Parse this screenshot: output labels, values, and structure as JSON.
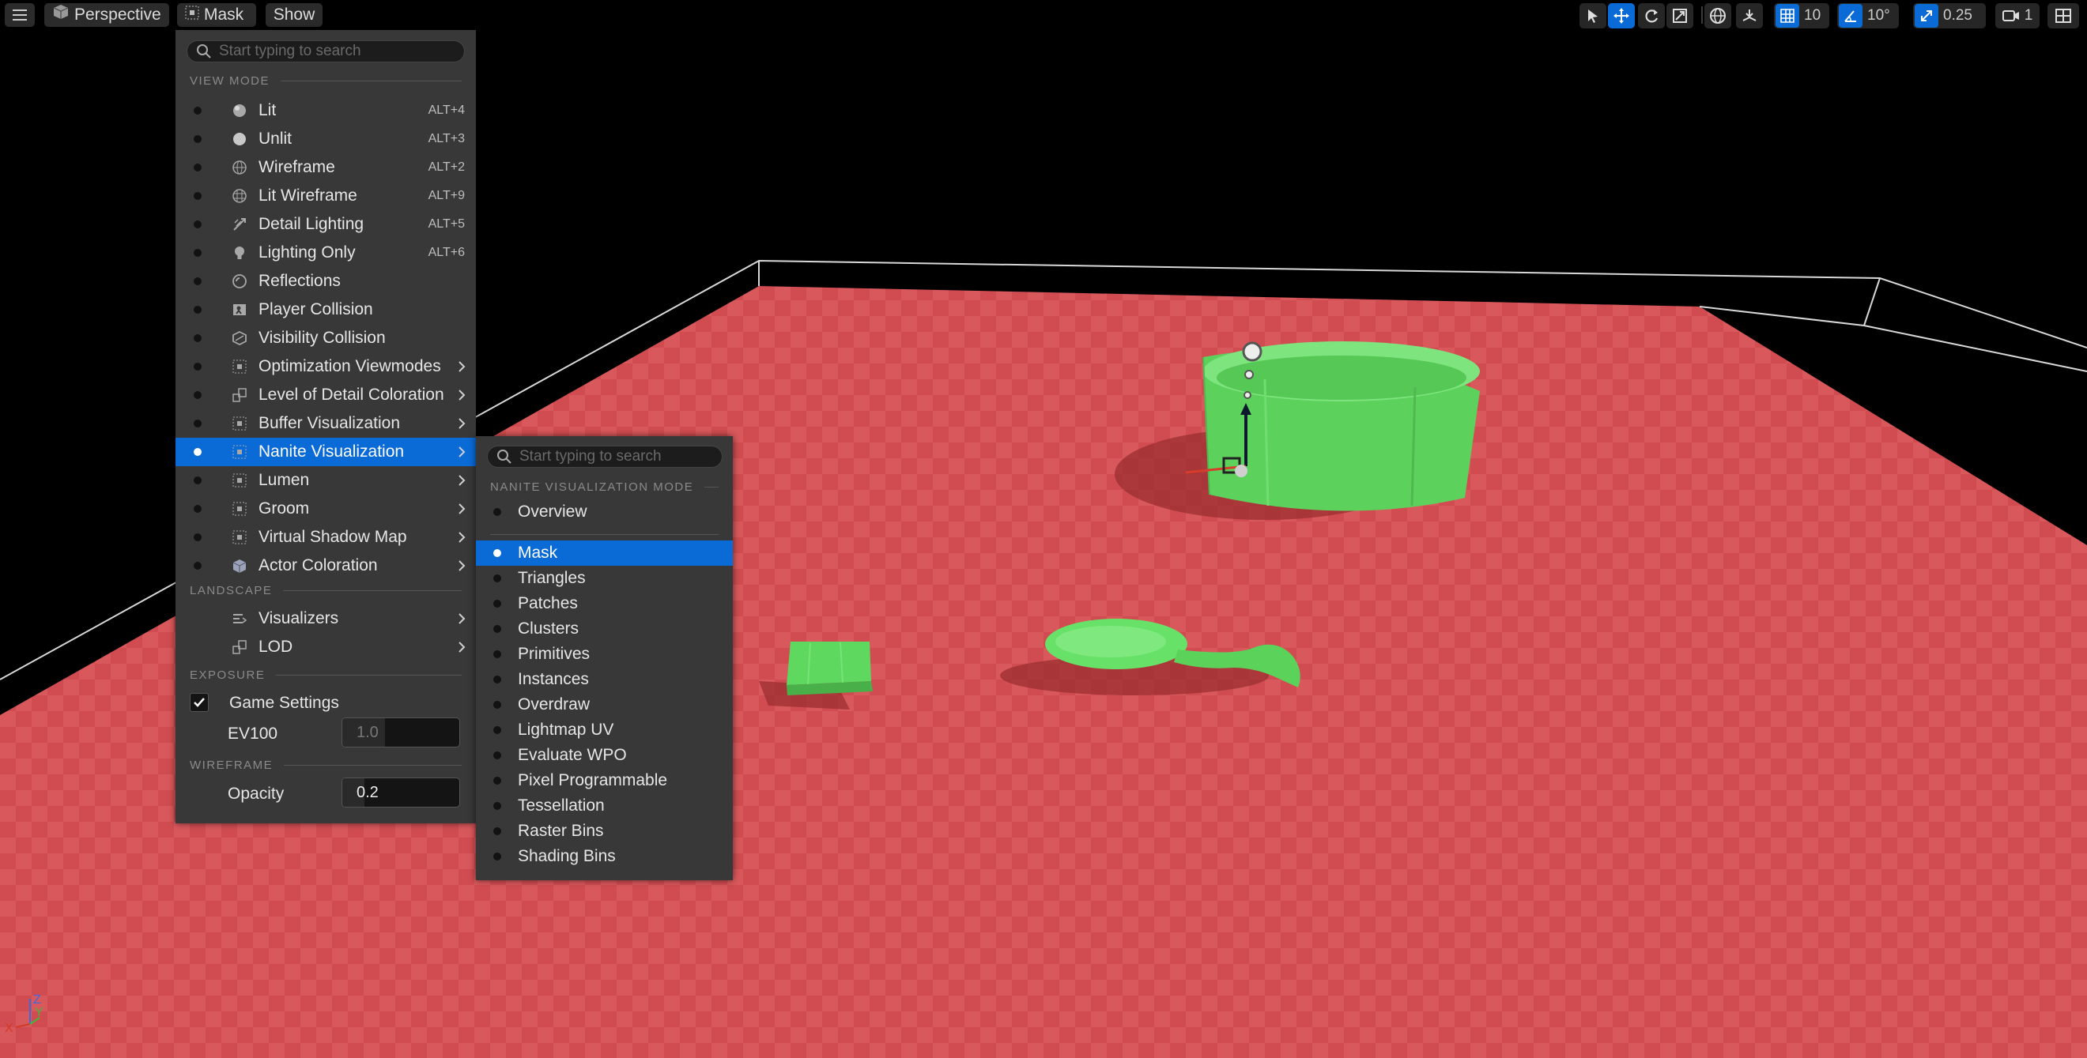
{
  "toolbar": {
    "perspective_label": "Perspective",
    "viewmode_label": "Mask",
    "show_label": "Show",
    "grid_snap_value": "10",
    "rotation_snap_value": "10°",
    "scale_snap_value": "0.25",
    "camera_speed_value": "1"
  },
  "main_menu": {
    "search_placeholder": "Start typing to search",
    "view_mode_header": "VIEW MODE",
    "items": [
      {
        "label": "Lit",
        "shortcut": "ALT+4",
        "icon": "lit-sphere-icon"
      },
      {
        "label": "Unlit",
        "shortcut": "ALT+3",
        "icon": "unlit-sphere-icon"
      },
      {
        "label": "Wireframe",
        "shortcut": "ALT+2",
        "icon": "wireframe-sphere-icon"
      },
      {
        "label": "Lit Wireframe",
        "shortcut": "ALT+9",
        "icon": "lit-wireframe-icon"
      },
      {
        "label": "Detail Lighting",
        "shortcut": "ALT+5",
        "icon": "detail-lighting-icon"
      },
      {
        "label": "Lighting Only",
        "shortcut": "ALT+6",
        "icon": "lightbulb-icon"
      },
      {
        "label": "Reflections",
        "shortcut": "",
        "icon": "reflections-icon"
      },
      {
        "label": "Player Collision",
        "shortcut": "",
        "icon": "player-collision-icon"
      },
      {
        "label": "Visibility Collision",
        "shortcut": "",
        "icon": "visibility-collision-icon"
      },
      {
        "label": "Optimization Viewmodes",
        "shortcut": "",
        "icon": "grid-dots-icon",
        "submenu": true
      },
      {
        "label": "Level of Detail Coloration",
        "shortcut": "",
        "icon": "lod-coloration-icon",
        "submenu": true
      },
      {
        "label": "Buffer Visualization",
        "shortcut": "",
        "icon": "grid-dots-icon",
        "submenu": true
      },
      {
        "label": "Nanite Visualization",
        "shortcut": "",
        "icon": "grid-dots-icon",
        "submenu": true,
        "selected": true
      },
      {
        "label": "Lumen",
        "shortcut": "",
        "icon": "grid-dots-icon",
        "submenu": true
      },
      {
        "label": "Groom",
        "shortcut": "",
        "icon": "grid-dots-icon",
        "submenu": true
      },
      {
        "label": "Virtual Shadow Map",
        "shortcut": "",
        "icon": "grid-dots-icon",
        "submenu": true
      },
      {
        "label": "Actor Coloration",
        "shortcut": "",
        "icon": "cube-icon",
        "submenu": true
      }
    ],
    "landscape_header": "LANDSCAPE",
    "landscape_items": [
      {
        "label": "Visualizers",
        "icon": "visualizers-icon",
        "submenu": true
      },
      {
        "label": "LOD",
        "icon": "lod-icon",
        "submenu": true
      }
    ],
    "exposure_header": "EXPOSURE",
    "game_settings_label": "Game Settings",
    "game_settings_checked": true,
    "ev100_label": "EV100",
    "ev100_value": "1.0",
    "wireframe_header": "WIREFRAME",
    "opacity_label": "Opacity",
    "opacity_value": "0.2"
  },
  "nanite_menu": {
    "search_placeholder": "Start typing to search",
    "header": "NANITE VISUALIZATION MODE",
    "overview_label": "Overview",
    "items": [
      {
        "label": "Mask",
        "selected": true
      },
      {
        "label": "Triangles"
      },
      {
        "label": "Patches"
      },
      {
        "label": "Clusters"
      },
      {
        "label": "Primitives"
      },
      {
        "label": "Instances"
      },
      {
        "label": "Overdraw"
      },
      {
        "label": "Lightmap UV"
      },
      {
        "label": "Evaluate WPO"
      },
      {
        "label": "Pixel Programmable"
      },
      {
        "label": "Tessellation"
      },
      {
        "label": "Raster Bins"
      },
      {
        "label": "Shading Bins"
      }
    ]
  },
  "axis_gizmo": {
    "x": "X",
    "y": "Y",
    "z": "Z"
  },
  "colors": {
    "floor": "#d95356",
    "mesh_green": "#63dd63",
    "accent_blue": "#0a6ad6",
    "menu_bg": "#383838"
  }
}
